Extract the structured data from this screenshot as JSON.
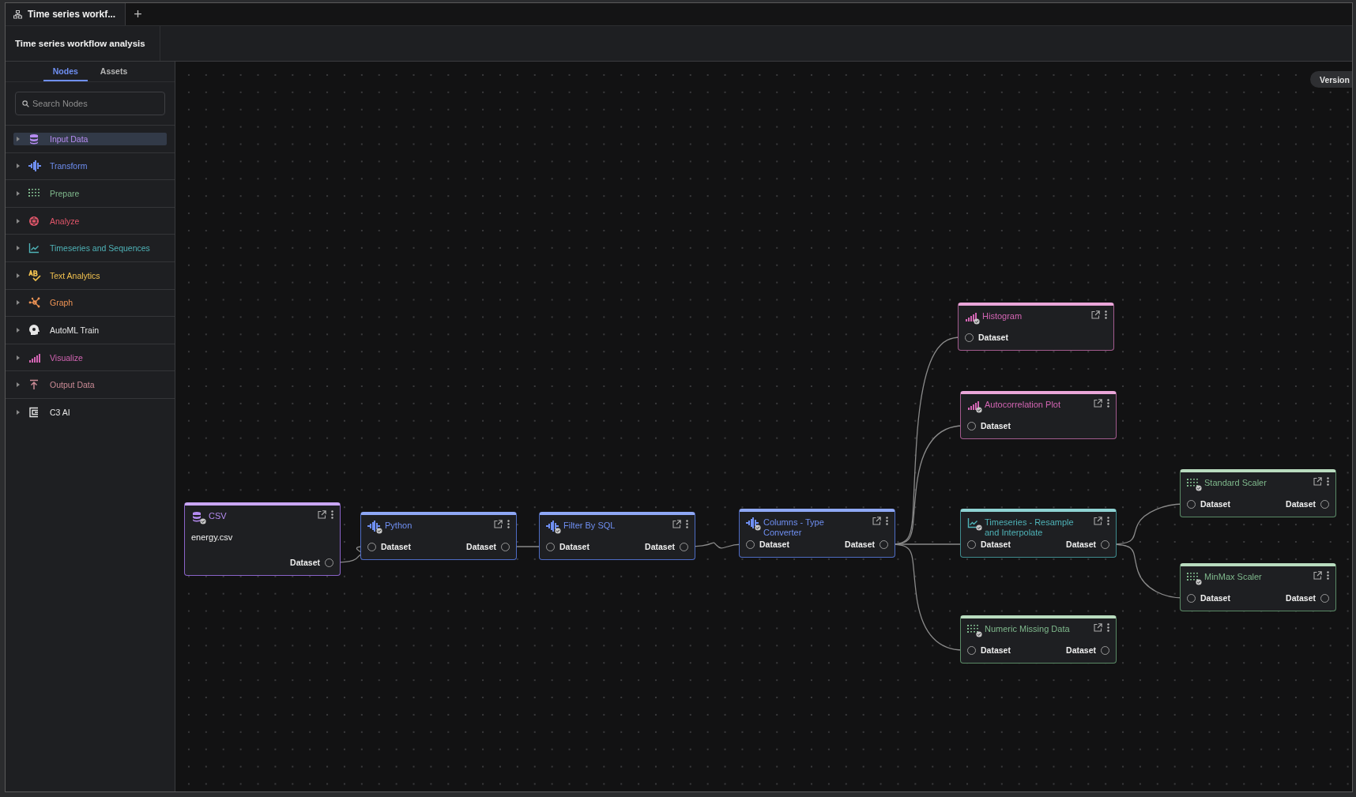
{
  "tabs": [
    {
      "label": "Time series workf...",
      "selected": true
    }
  ],
  "new_tab_button": "+",
  "header": {
    "title": "Time series workflow analysis"
  },
  "sidebar": {
    "tabs": [
      {
        "label": "Nodes",
        "selected": true
      },
      {
        "label": "Assets",
        "selected": false
      }
    ],
    "search": {
      "placeholder": "Search Nodes"
    },
    "items": [
      {
        "label": "Input Data",
        "kind": "database",
        "color": "#b68cf2",
        "selected": true,
        "expanded": false
      },
      {
        "label": "Transform",
        "kind": "wave",
        "color": "#6f8ff2",
        "selected": false,
        "expanded": false
      },
      {
        "label": "Prepare",
        "kind": "dots",
        "color": "#7fb88c",
        "selected": false,
        "expanded": false
      },
      {
        "label": "Analyze",
        "kind": "globe",
        "color": "#e0566a",
        "selected": false,
        "expanded": false
      },
      {
        "label": "Timeseries and Sequences",
        "kind": "chart",
        "color": "#4fb3b8",
        "selected": false,
        "expanded": false
      },
      {
        "label": "Text Analytics",
        "kind": "text",
        "color": "#f0c04f",
        "selected": false,
        "expanded": false
      },
      {
        "label": "Graph",
        "kind": "graph",
        "color": "#ef9455",
        "selected": false,
        "expanded": false
      },
      {
        "label": "AutoML Train",
        "kind": "head",
        "color": "#e6e6e6",
        "selected": false,
        "expanded": false
      },
      {
        "label": "Visualize",
        "kind": "bars",
        "color": "#d465b4",
        "selected": false,
        "expanded": false
      },
      {
        "label": "Output Data",
        "kind": "upload",
        "color": "#c98a94",
        "selected": false,
        "expanded": false
      },
      {
        "label": "C3 AI",
        "kind": "logo",
        "color": "#e6e6e6",
        "selected": false,
        "expanded": false
      }
    ]
  },
  "canvas": {
    "version_button": "Version",
    "nodes": [
      {
        "title": "CSV",
        "kind": "database",
        "body": "energy.csv",
        "output": "Dataset"
      },
      {
        "title": "Python",
        "kind": "wave",
        "input": "Dataset",
        "output": "Dataset"
      },
      {
        "title": "Filter By SQL",
        "kind": "wave",
        "input": "Dataset",
        "output": "Dataset"
      },
      {
        "title": "Columns - Type Converter",
        "kind": "wave",
        "input": "Dataset",
        "output": "Dataset"
      },
      {
        "title": "Histogram",
        "kind": "bars",
        "input": "Dataset"
      },
      {
        "title": "Autocorrelation Plot",
        "kind": "bars",
        "input": "Dataset"
      },
      {
        "title": "Timeseries - Resample and Interpolate",
        "kind": "chart",
        "input": "Dataset",
        "output": "Dataset"
      },
      {
        "title": "Numeric Missing Data",
        "kind": "dots",
        "input": "Dataset",
        "output": "Dataset"
      },
      {
        "title": "Standard Scaler",
        "kind": "dots",
        "input": "Dataset",
        "output": "Dataset"
      },
      {
        "title": "MinMax Scaler",
        "kind": "dots",
        "input": "Dataset",
        "output": "Dataset"
      }
    ]
  }
}
